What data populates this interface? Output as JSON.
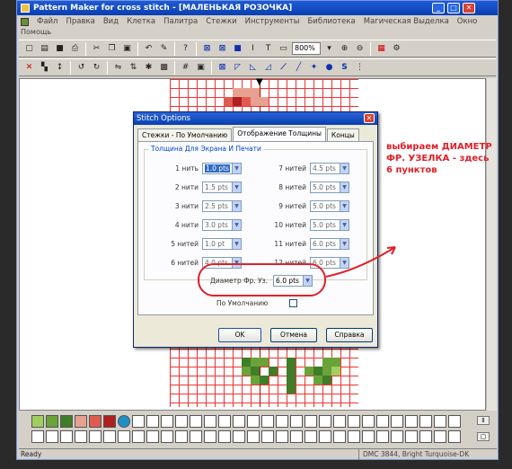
{
  "window": {
    "title": "Pattern Maker for cross stitch - [МАЛЕНЬКАЯ РОЗОЧКА]",
    "buttons": [
      "_",
      "□",
      "✕"
    ]
  },
  "menu": [
    "Файл",
    "Правка",
    "Вид",
    "Клетка",
    "Палитра",
    "Стежки",
    "Инструменты",
    "Библиотека",
    "Магическая Выделка",
    "Окно"
  ],
  "subbar": "Помощь",
  "toolbar": {
    "zoom": "800%"
  },
  "dialog": {
    "title": "Stitch Options",
    "close": "✕",
    "tabs": [
      "Стежки - По Умолчанию",
      "Отображение Толщины",
      "Концы"
    ],
    "group_label": "Толщина Для Экрана И Печати",
    "left_rows": [
      {
        "label": "1 нить",
        "value": "1.0 pts",
        "selected": true
      },
      {
        "label": "2 нити",
        "value": "1.5 pts",
        "selected": false
      },
      {
        "label": "3 нити",
        "value": "2.5 pts",
        "selected": false
      },
      {
        "label": "4 нити",
        "value": "3.0 pts",
        "selected": false
      },
      {
        "label": "5 нитей",
        "value": "1.0 pt",
        "selected": false
      },
      {
        "label": "6 нитей",
        "value": "4.0 pts",
        "selected": false
      }
    ],
    "right_rows": [
      {
        "label": "7 нитей",
        "value": "4.5 pts"
      },
      {
        "label": "8 нитей",
        "value": "5.0 pts"
      },
      {
        "label": "9 нитей",
        "value": "5.0 pts"
      },
      {
        "label": "10 нитей",
        "value": "5.0 pts"
      },
      {
        "label": "11 нитей",
        "value": "6.0 pts"
      },
      {
        "label": "12 нитей",
        "value": "6.0 pts"
      }
    ],
    "diameter_label": "Диаметр Фр. Уз.",
    "diameter_value": "6.0 pts",
    "default_label": "По Умолчанию",
    "ok": "OK",
    "cancel": "Отмена",
    "help": "Справка"
  },
  "annotation": "выбираем ДИАМЕТР ФР. УЗЕЛКА - здесь 6 пунктов",
  "palette_colors": [
    "#9fcf60",
    "#6aa33a",
    "#3f7d28",
    "#e8a090",
    "#e05a50",
    "#b02020",
    "#1f8fc8"
  ],
  "status": {
    "left": "Ready",
    "right": "DMC 3844, Bright Turquoise-DK"
  },
  "colors": {
    "accent_red": "#e0202a",
    "grid_red": "#e33"
  }
}
